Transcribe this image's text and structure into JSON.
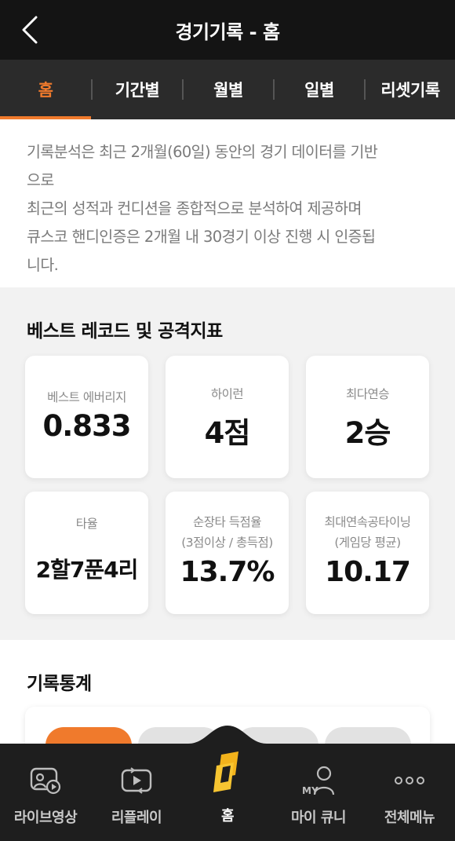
{
  "header": {
    "title": "경기기록 - 홈"
  },
  "tabs": [
    {
      "label": "홈",
      "active": true
    },
    {
      "label": "기간별",
      "active": false
    },
    {
      "label": "월별",
      "active": false
    },
    {
      "label": "일별",
      "active": false
    },
    {
      "label": "리셋기록",
      "active": false
    }
  ],
  "intro": {
    "lines": [
      "기록분석은 최근 2개월(60일) 동안의 경기 데이터를 기반",
      "으로",
      "최근의 성적과 컨디션을 종합적으로 분석하여 제공하며",
      "큐스코 핸디인증은 2개월 내 30경기 이상 진행 시 인증됩",
      "니다."
    ]
  },
  "best": {
    "title": "베스트 레코드 및 공격지표",
    "cards": [
      {
        "label": "베스트 에버리지",
        "sub": "",
        "value": "0.833"
      },
      {
        "label": "하이런",
        "sub": "",
        "value": "4점"
      },
      {
        "label": "최다연승",
        "sub": "",
        "value": "2승"
      },
      {
        "label": "타율",
        "sub": "",
        "value": "2할7푼4리"
      },
      {
        "label": "순장타 득점율",
        "sub": "(3점이상 / 총득점)",
        "value": "13.7%"
      },
      {
        "label": "최대연속공타이닝",
        "sub": "(게임당 평균)",
        "value": "10.17"
      }
    ]
  },
  "stats": {
    "title": "기록통계"
  },
  "colors": {
    "accent": "#f07a2c",
    "header_bg": "#141414",
    "tab_bg": "#2b2b2b",
    "nav_bg": "#1e1e1e"
  },
  "nav": [
    {
      "label": "라이브영상",
      "icon": "live-video-icon"
    },
    {
      "label": "리플레이",
      "icon": "replay-icon"
    },
    {
      "label": "홈",
      "icon": "home-logo-icon",
      "active": true
    },
    {
      "label": "마이 큐니",
      "icon": "my-profile-icon",
      "badge": "MY"
    },
    {
      "label": "전체메뉴",
      "icon": "more-menu-icon"
    }
  ]
}
